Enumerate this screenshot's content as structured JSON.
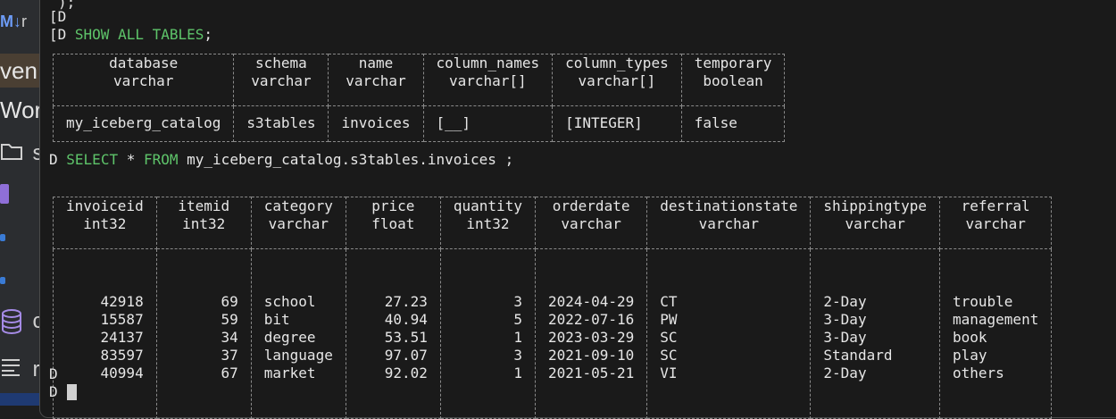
{
  "background_editor": {
    "md_badge": "M↓",
    "md_char": "r",
    "item1": "ven",
    "item2": "Wor",
    "folder_char": "s",
    "db_char": "c",
    "lines_char": "r"
  },
  "terminal": {
    "top_fragment": ");",
    "line_d1": "[D",
    "line_d2": "[D",
    "cmd1": {
      "keyword": "SHOW ALL TABLES",
      "suffix": ";"
    },
    "table1": {
      "columns": [
        {
          "name": "database",
          "type": "varchar"
        },
        {
          "name": "schema",
          "type": "varchar"
        },
        {
          "name": "name",
          "type": "varchar"
        },
        {
          "name": "column_names",
          "type": "varchar[]"
        },
        {
          "name": "column_types",
          "type": "varchar[]"
        },
        {
          "name": "temporary",
          "type": "boolean"
        }
      ],
      "row": [
        "my_iceberg_catalog",
        "s3tables",
        "invoices",
        "[__]",
        "[INTEGER]",
        "false"
      ]
    },
    "cmd2": {
      "prompt": "D",
      "kw_select": "SELECT",
      "star": " * ",
      "kw_from": "FROM",
      "rest": " my_iceberg_catalog.s3tables.invoices ;"
    },
    "table2": {
      "columns": [
        {
          "name": "invoiceid",
          "type": "int32"
        },
        {
          "name": "itemid",
          "type": "int32"
        },
        {
          "name": "category",
          "type": "varchar"
        },
        {
          "name": "price",
          "type": "float"
        },
        {
          "name": "quantity",
          "type": "int32"
        },
        {
          "name": "orderdate",
          "type": "varchar"
        },
        {
          "name": "destinationstate",
          "type": "varchar"
        },
        {
          "name": "shippingtype",
          "type": "varchar"
        },
        {
          "name": "referral",
          "type": "varchar"
        }
      ],
      "rows": [
        [
          "42918",
          "69",
          "school",
          "27.23",
          "3",
          "2024-04-29",
          "CT",
          "2-Day",
          "trouble"
        ],
        [
          "15587",
          "59",
          "bit",
          "40.94",
          "5",
          "2022-07-16",
          "PW",
          "3-Day",
          "management"
        ],
        [
          "24137",
          "34",
          "degree",
          "53.51",
          "1",
          "2023-03-29",
          "SC",
          "3-Day",
          "book"
        ],
        [
          "83597",
          "37",
          "language",
          "97.07",
          "3",
          "2021-09-10",
          "SC",
          "Standard",
          "play"
        ],
        [
          "40994",
          "67",
          "market",
          "92.02",
          "1",
          "2021-05-21",
          "VI",
          "2-Day",
          "others"
        ]
      ]
    },
    "prompt_line1": "D",
    "prompt_line2": "D"
  }
}
